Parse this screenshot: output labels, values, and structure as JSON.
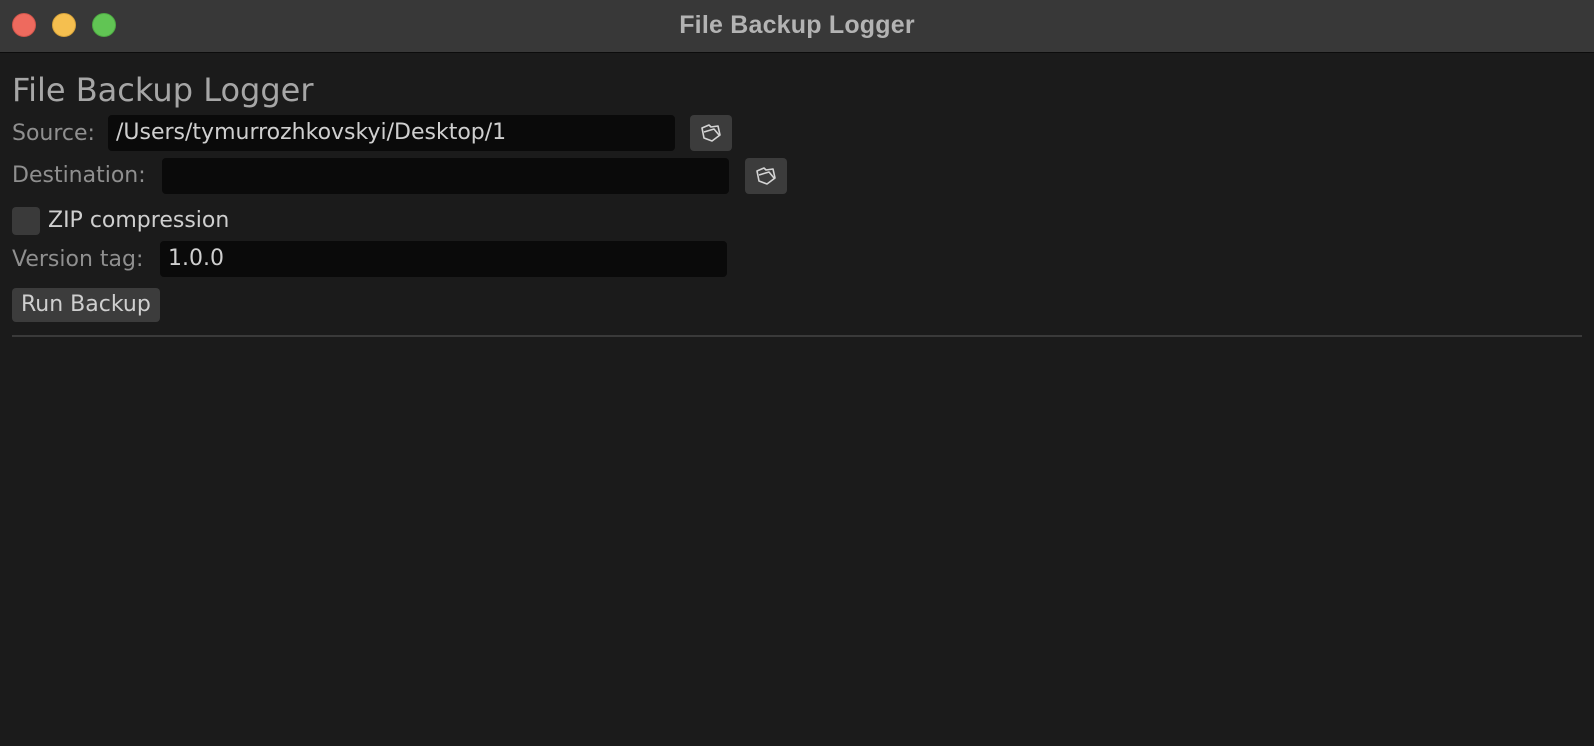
{
  "window": {
    "title": "File Backup Logger"
  },
  "main": {
    "heading": "File Backup Logger",
    "source": {
      "label": "Source:",
      "value": "/Users/tymurrozhkovskyi/Desktop/1",
      "browse_icon": "folder-icon"
    },
    "destination": {
      "label": "Destination:",
      "value": "",
      "browse_icon": "folder-icon"
    },
    "zip": {
      "label": "ZIP compression",
      "checked": false
    },
    "version": {
      "label": "Version tag:",
      "value": "1.0.0"
    },
    "run_button": "Run Backup"
  },
  "colors": {
    "background": "#1b1b1b",
    "titlebar": "#383838",
    "field": "#0a0a0a",
    "button": "#3c3c3c",
    "close": "#ee6a5e",
    "minimize": "#f5bf4f",
    "maximize": "#61c554"
  }
}
